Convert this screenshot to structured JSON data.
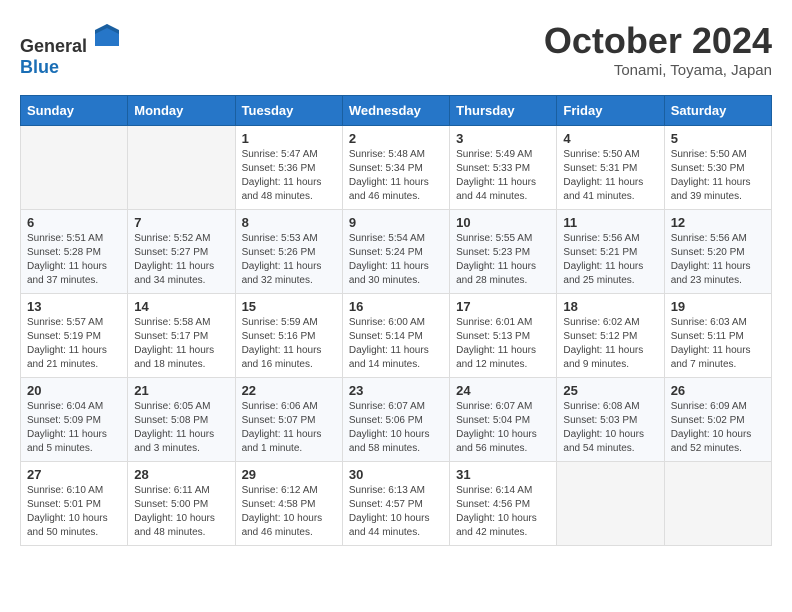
{
  "header": {
    "logo_general": "General",
    "logo_blue": "Blue",
    "month": "October 2024",
    "location": "Tonami, Toyama, Japan"
  },
  "weekdays": [
    "Sunday",
    "Monday",
    "Tuesday",
    "Wednesday",
    "Thursday",
    "Friday",
    "Saturday"
  ],
  "weeks": [
    [
      {
        "day": "",
        "info": ""
      },
      {
        "day": "",
        "info": ""
      },
      {
        "day": "1",
        "info": "Sunrise: 5:47 AM\nSunset: 5:36 PM\nDaylight: 11 hours and 48 minutes."
      },
      {
        "day": "2",
        "info": "Sunrise: 5:48 AM\nSunset: 5:34 PM\nDaylight: 11 hours and 46 minutes."
      },
      {
        "day": "3",
        "info": "Sunrise: 5:49 AM\nSunset: 5:33 PM\nDaylight: 11 hours and 44 minutes."
      },
      {
        "day": "4",
        "info": "Sunrise: 5:50 AM\nSunset: 5:31 PM\nDaylight: 11 hours and 41 minutes."
      },
      {
        "day": "5",
        "info": "Sunrise: 5:50 AM\nSunset: 5:30 PM\nDaylight: 11 hours and 39 minutes."
      }
    ],
    [
      {
        "day": "6",
        "info": "Sunrise: 5:51 AM\nSunset: 5:28 PM\nDaylight: 11 hours and 37 minutes."
      },
      {
        "day": "7",
        "info": "Sunrise: 5:52 AM\nSunset: 5:27 PM\nDaylight: 11 hours and 34 minutes."
      },
      {
        "day": "8",
        "info": "Sunrise: 5:53 AM\nSunset: 5:26 PM\nDaylight: 11 hours and 32 minutes."
      },
      {
        "day": "9",
        "info": "Sunrise: 5:54 AM\nSunset: 5:24 PM\nDaylight: 11 hours and 30 minutes."
      },
      {
        "day": "10",
        "info": "Sunrise: 5:55 AM\nSunset: 5:23 PM\nDaylight: 11 hours and 28 minutes."
      },
      {
        "day": "11",
        "info": "Sunrise: 5:56 AM\nSunset: 5:21 PM\nDaylight: 11 hours and 25 minutes."
      },
      {
        "day": "12",
        "info": "Sunrise: 5:56 AM\nSunset: 5:20 PM\nDaylight: 11 hours and 23 minutes."
      }
    ],
    [
      {
        "day": "13",
        "info": "Sunrise: 5:57 AM\nSunset: 5:19 PM\nDaylight: 11 hours and 21 minutes."
      },
      {
        "day": "14",
        "info": "Sunrise: 5:58 AM\nSunset: 5:17 PM\nDaylight: 11 hours and 18 minutes."
      },
      {
        "day": "15",
        "info": "Sunrise: 5:59 AM\nSunset: 5:16 PM\nDaylight: 11 hours and 16 minutes."
      },
      {
        "day": "16",
        "info": "Sunrise: 6:00 AM\nSunset: 5:14 PM\nDaylight: 11 hours and 14 minutes."
      },
      {
        "day": "17",
        "info": "Sunrise: 6:01 AM\nSunset: 5:13 PM\nDaylight: 11 hours and 12 minutes."
      },
      {
        "day": "18",
        "info": "Sunrise: 6:02 AM\nSunset: 5:12 PM\nDaylight: 11 hours and 9 minutes."
      },
      {
        "day": "19",
        "info": "Sunrise: 6:03 AM\nSunset: 5:11 PM\nDaylight: 11 hours and 7 minutes."
      }
    ],
    [
      {
        "day": "20",
        "info": "Sunrise: 6:04 AM\nSunset: 5:09 PM\nDaylight: 11 hours and 5 minutes."
      },
      {
        "day": "21",
        "info": "Sunrise: 6:05 AM\nSunset: 5:08 PM\nDaylight: 11 hours and 3 minutes."
      },
      {
        "day": "22",
        "info": "Sunrise: 6:06 AM\nSunset: 5:07 PM\nDaylight: 11 hours and 1 minute."
      },
      {
        "day": "23",
        "info": "Sunrise: 6:07 AM\nSunset: 5:06 PM\nDaylight: 10 hours and 58 minutes."
      },
      {
        "day": "24",
        "info": "Sunrise: 6:07 AM\nSunset: 5:04 PM\nDaylight: 10 hours and 56 minutes."
      },
      {
        "day": "25",
        "info": "Sunrise: 6:08 AM\nSunset: 5:03 PM\nDaylight: 10 hours and 54 minutes."
      },
      {
        "day": "26",
        "info": "Sunrise: 6:09 AM\nSunset: 5:02 PM\nDaylight: 10 hours and 52 minutes."
      }
    ],
    [
      {
        "day": "27",
        "info": "Sunrise: 6:10 AM\nSunset: 5:01 PM\nDaylight: 10 hours and 50 minutes."
      },
      {
        "day": "28",
        "info": "Sunrise: 6:11 AM\nSunset: 5:00 PM\nDaylight: 10 hours and 48 minutes."
      },
      {
        "day": "29",
        "info": "Sunrise: 6:12 AM\nSunset: 4:58 PM\nDaylight: 10 hours and 46 minutes."
      },
      {
        "day": "30",
        "info": "Sunrise: 6:13 AM\nSunset: 4:57 PM\nDaylight: 10 hours and 44 minutes."
      },
      {
        "day": "31",
        "info": "Sunrise: 6:14 AM\nSunset: 4:56 PM\nDaylight: 10 hours and 42 minutes."
      },
      {
        "day": "",
        "info": ""
      },
      {
        "day": "",
        "info": ""
      }
    ]
  ]
}
